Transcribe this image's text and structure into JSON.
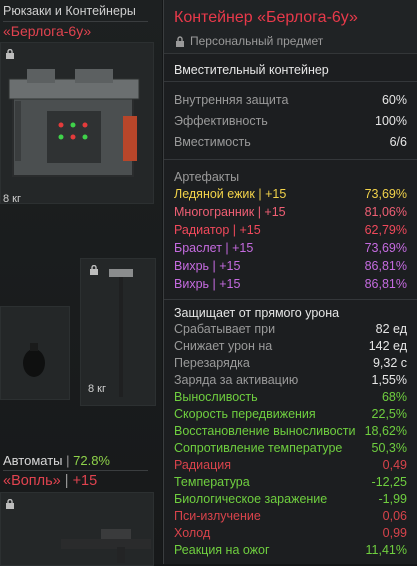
{
  "left": {
    "category1": "Рюкзаки и Контейнеры",
    "item1_name": "«Берлога-6у»",
    "item1_weight": "8 кг",
    "item2_weight": "8 кг",
    "category2_name": "Автоматы",
    "category2_sep": " | ",
    "category2_pct": "72.8%",
    "item3_name": "«Вопль»",
    "item3_sep": " | ",
    "item3_bonus": "+15"
  },
  "tooltip": {
    "title": "Контейнер «Берлога-6у»",
    "subtitle": "Персональный предмет",
    "desc": "Вместительный контейнер",
    "stats": [
      {
        "label": "Внутренняя защита",
        "value": "60%"
      },
      {
        "label": "Эффективность",
        "value": "100%"
      },
      {
        "label": "Вместимость",
        "value": "6/6"
      }
    ],
    "artifacts_title": "Артефакты",
    "artifacts": [
      {
        "label": "Ледяной ежик | +15",
        "value": "73,69%"
      },
      {
        "label": "Многогранник | +15",
        "value": "81,06%"
      },
      {
        "label": "Радиатор | +15",
        "value": "62,79%"
      },
      {
        "label": "Браслет | +15",
        "value": "73,69%"
      },
      {
        "label": "Вихрь | +15",
        "value": "86,81%"
      },
      {
        "label": "Вихрь | +15",
        "value": "86,81%"
      }
    ],
    "protect_title": "Защищает от прямого урона",
    "protect": [
      {
        "label": "Срабатывает при",
        "value": "82 ед"
      },
      {
        "label": "Снижает урон на",
        "value": "142 ед"
      },
      {
        "label": "Перезарядка",
        "value": "9,32 с"
      },
      {
        "label": "Заряда за активацию",
        "value": "1,55%"
      }
    ],
    "effects": [
      {
        "label": "Выносливость",
        "value": "68%"
      },
      {
        "label": "Скорость передвижения",
        "value": "22,5%"
      },
      {
        "label": "Восстановление выносливости",
        "value": "18,62%"
      },
      {
        "label": "Сопротивление температуре",
        "value": "50,3%"
      },
      {
        "label": "Радиация",
        "value": "0,49"
      },
      {
        "label": "Температура",
        "value": "-12,25"
      },
      {
        "label": "Биологическое заражение",
        "value": "-1,99"
      },
      {
        "label": "Пси-излучение",
        "value": "0,06"
      },
      {
        "label": "Холод",
        "value": "0,99"
      },
      {
        "label": "Реакция на ожог",
        "value": "11,41%"
      }
    ]
  },
  "colors": {
    "title_red": "#e8394a",
    "positive_green": "#6fcf3f",
    "negative_red": "#d8434b",
    "artifact_yellow": "#f2d34a",
    "artifact_pink": "#ef5f74",
    "artifact_red": "#f0495b",
    "artifact_purple": "#c56be0"
  },
  "icons": [
    "lock-icon",
    "container-image",
    "hammer-image",
    "grenade-image",
    "rifle-image"
  ]
}
